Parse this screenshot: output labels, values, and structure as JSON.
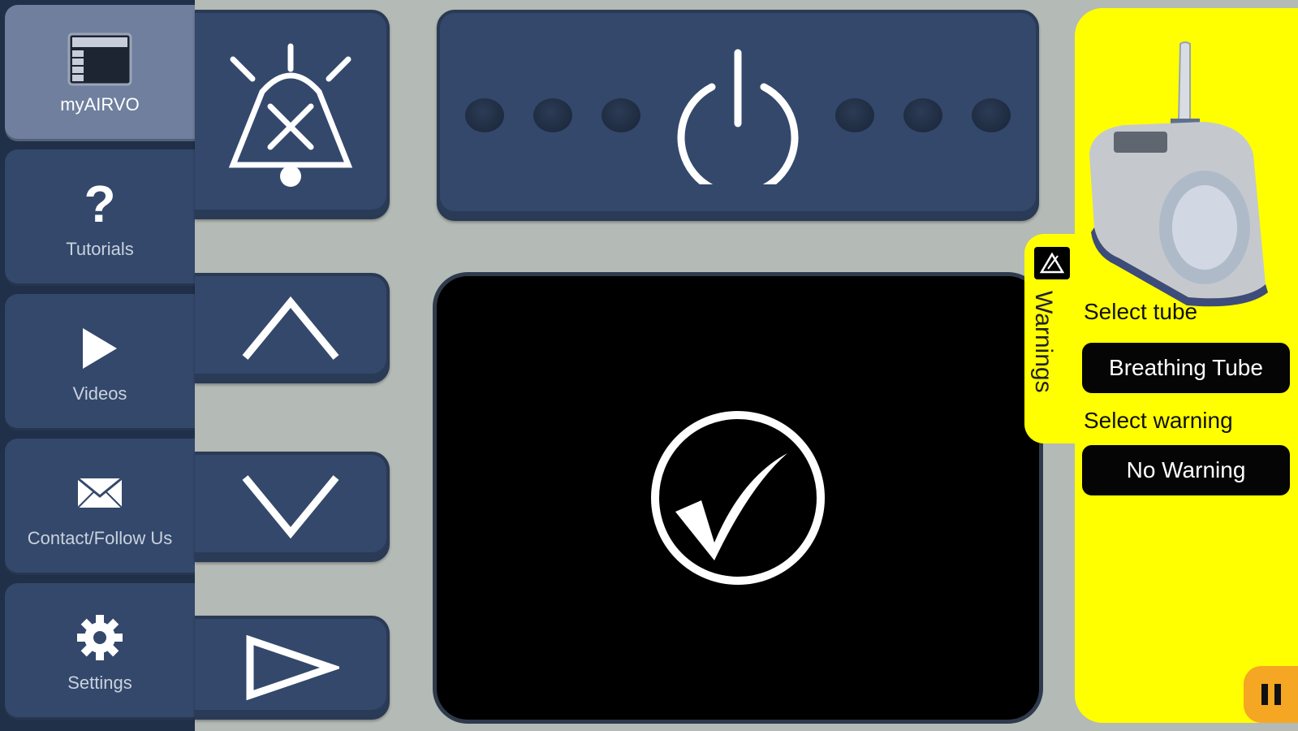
{
  "sidebar": {
    "items": [
      {
        "label": "myAIRVO",
        "icon": "dashboard-icon",
        "active": true
      },
      {
        "label": "Tutorials",
        "icon": "question-icon"
      },
      {
        "label": "Videos",
        "icon": "play-icon"
      },
      {
        "label": "Contact/Follow Us",
        "icon": "envelope-icon"
      },
      {
        "label": "Settings",
        "icon": "gear-icon"
      }
    ]
  },
  "controls": {
    "mute": {
      "icon": "alarm-mute-icon"
    },
    "power": {
      "icon": "power-icon"
    },
    "up": {
      "icon": "up-chevron-icon"
    },
    "down": {
      "icon": "down-chevron-icon"
    },
    "next": {
      "icon": "right-triangle-icon"
    }
  },
  "display": {
    "icon": "checkmark-circle-icon"
  },
  "warnings": {
    "tab_label": "Warnings",
    "tab_icon": "warning-triangle-icon",
    "select_tube_label": "Select tube",
    "tube_value": "Breathing Tube",
    "select_warning_label": "Select warning",
    "warning_value": "No Warning"
  },
  "colors": {
    "background": "#b4bab5",
    "sidebar": "#1f3048",
    "button": "#33486b",
    "active": "#6f7f9d",
    "warning_panel": "#ffff00",
    "pause": "#f5a623"
  },
  "pause": {
    "icon": "pause-icon"
  }
}
